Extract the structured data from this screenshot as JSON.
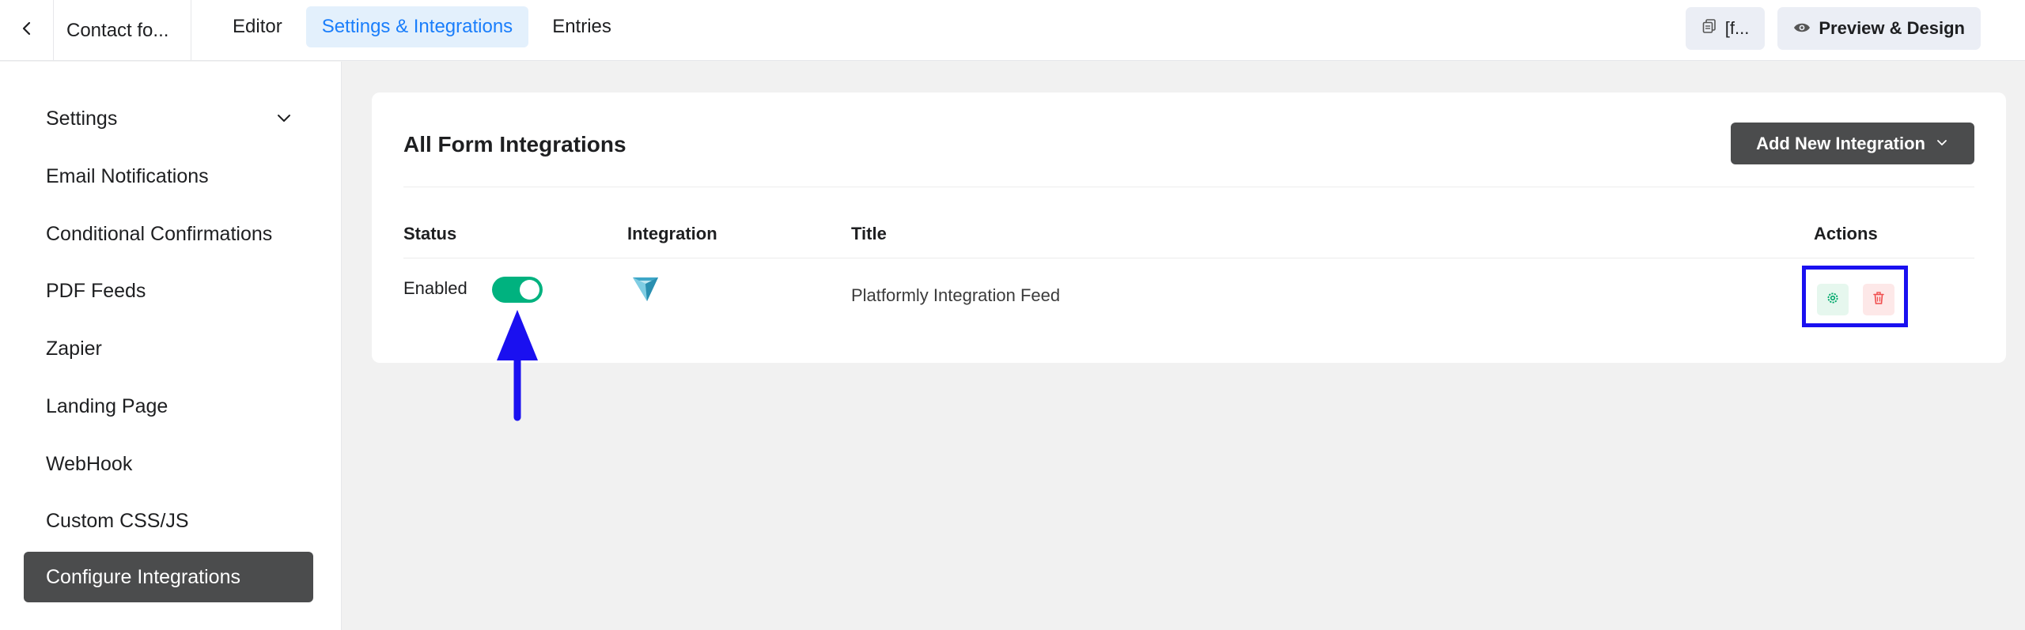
{
  "topbar": {
    "back_icon": "chevron-left-icon",
    "form_title": "Contact fo...",
    "tabs": [
      {
        "label": "Editor",
        "active": false
      },
      {
        "label": "Settings & Integrations",
        "active": true
      },
      {
        "label": "Entries",
        "active": false
      }
    ],
    "shortcode_button": {
      "icon": "copy-icon",
      "label": "[f..."
    },
    "preview_button": {
      "icon": "eye-icon",
      "label": "Preview & Design"
    }
  },
  "sidebar": {
    "items": [
      {
        "label": "Settings",
        "has_chevron": true,
        "active": false
      },
      {
        "label": "Email Notifications",
        "active": false
      },
      {
        "label": "Conditional Confirmations",
        "active": false
      },
      {
        "label": "PDF Feeds",
        "active": false
      },
      {
        "label": "Zapier",
        "active": false
      },
      {
        "label": "Landing Page",
        "active": false
      },
      {
        "label": "WebHook",
        "active": false
      },
      {
        "label": "Custom CSS/JS",
        "active": false
      },
      {
        "label": "Configure Integrations",
        "active": true
      }
    ]
  },
  "main": {
    "title": "All Form Integrations",
    "add_button": "Add New Integration",
    "columns": {
      "status": "Status",
      "integration": "Integration",
      "title": "Title",
      "actions": "Actions"
    },
    "rows": [
      {
        "status_text": "Enabled",
        "enabled": true,
        "integration_icon": "platformly-logo-icon",
        "title": "Platformly Integration Feed",
        "actions": [
          "settings-icon",
          "trash-icon"
        ]
      }
    ]
  },
  "colors": {
    "accent_blue": "#1a7efb",
    "toggle_green": "#00b27f",
    "dark_button": "#4b4c4d",
    "annotation_blue": "#1a10f0",
    "delete_red": "#f04e4e"
  }
}
